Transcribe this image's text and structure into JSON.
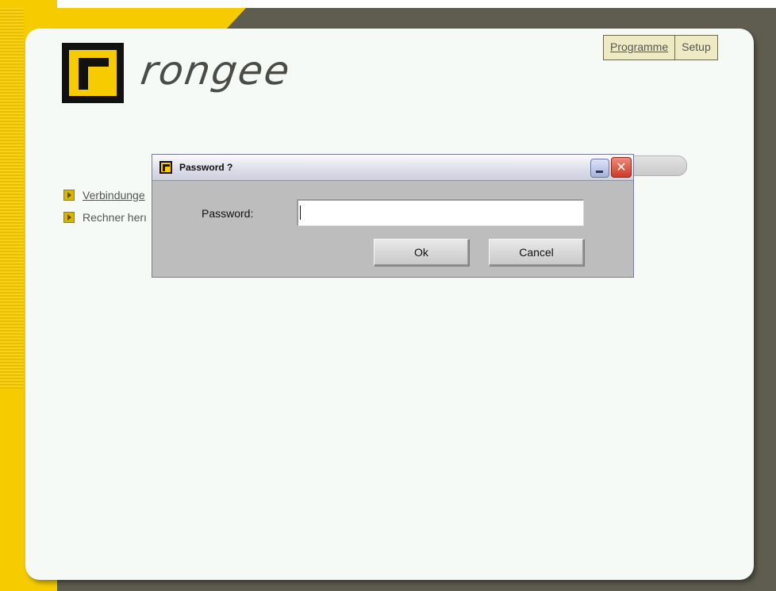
{
  "logo": {
    "text": "rongee"
  },
  "topnav": {
    "tabs": [
      {
        "label": "Programme"
      },
      {
        "label": "Setup"
      }
    ]
  },
  "menu": {
    "items": [
      {
        "label": "Verbindunge"
      },
      {
        "label": "Rechner herı"
      }
    ]
  },
  "dialog": {
    "title": "Password ?",
    "password_label": "Password:",
    "password_value": "",
    "ok_label": "Ok",
    "cancel_label": "Cancel",
    "close_glyph": "✕"
  },
  "colors": {
    "accent_yellow": "#f6cc00",
    "desktop_dark": "#5f5d4f",
    "page_bg": "#f5faf7"
  },
  "icons": [
    "logo-icon",
    "arrow-right-icon",
    "minimize-icon",
    "close-icon"
  ]
}
